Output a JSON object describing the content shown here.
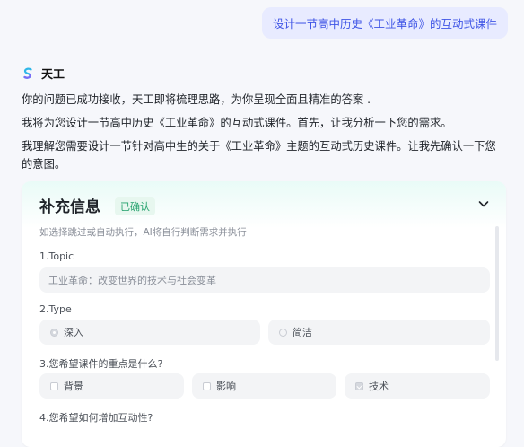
{
  "user_message": "设计一节高中历史《工业革命》的互动式课件",
  "assistant": {
    "name": "天工",
    "messages": [
      "你的问题已成功接收，天工即将梳理思路，为你呈现全面且精准的答案 .",
      "我将为您设计一节高中历史《工业革命》的互动式课件。首先，让我分析一下您的需求。",
      "我理解您需要设计一节针对高中生的关于《工业革命》主题的互动式历史课件。让我先确认一下您的意图。"
    ]
  },
  "panel": {
    "title": "补充信息",
    "status_badge": "已确认",
    "hint": "如选择跳过或自动执行，AI将自行判断需求并执行",
    "topic_label": "1.Topic",
    "topic_value": "工业革命：改变世界的技术与社会变革",
    "type_label": "2.Type",
    "type_options": [
      {
        "label": "深入",
        "selected": true
      },
      {
        "label": "简洁",
        "selected": false
      }
    ],
    "focus_label": "3.您希望课件的重点是什么?",
    "focus_options": [
      {
        "label": "背景",
        "checked": false
      },
      {
        "label": "影响",
        "checked": false
      },
      {
        "label": "技术",
        "checked": true
      }
    ],
    "interaction_label": "4.您希望如何增加互动性?"
  },
  "colors": {
    "accent": "#3f55e6",
    "success": "#22a06b",
    "background": "#f6f7fb"
  }
}
